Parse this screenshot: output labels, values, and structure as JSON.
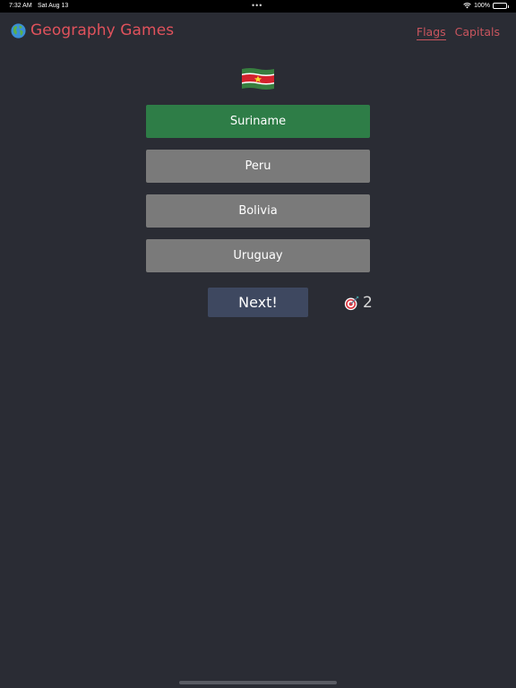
{
  "status_bar": {
    "time": "7:32 AM",
    "date": "Sat Aug 13",
    "battery": "100%"
  },
  "header": {
    "title": "Geography Games",
    "icon": "globe-icon",
    "title_color": "#e0525c"
  },
  "nav": {
    "items": [
      {
        "label": "Flags",
        "active": true
      },
      {
        "label": "Capitals",
        "active": false
      }
    ]
  },
  "quiz": {
    "flag": "Suriname",
    "options": [
      {
        "label": "Suriname",
        "state": "correct"
      },
      {
        "label": "Peru",
        "state": "neutral"
      },
      {
        "label": "Bolivia",
        "state": "neutral"
      },
      {
        "label": "Uruguay",
        "state": "neutral"
      }
    ],
    "next_label": "Next!",
    "score": "2",
    "score_icon": "target-icon"
  },
  "colors": {
    "background": "#2a2c34",
    "correct": "#2e7d47",
    "neutral": "#7a7a7a",
    "next_button": "#3e4860",
    "accent": "#c9555e"
  }
}
